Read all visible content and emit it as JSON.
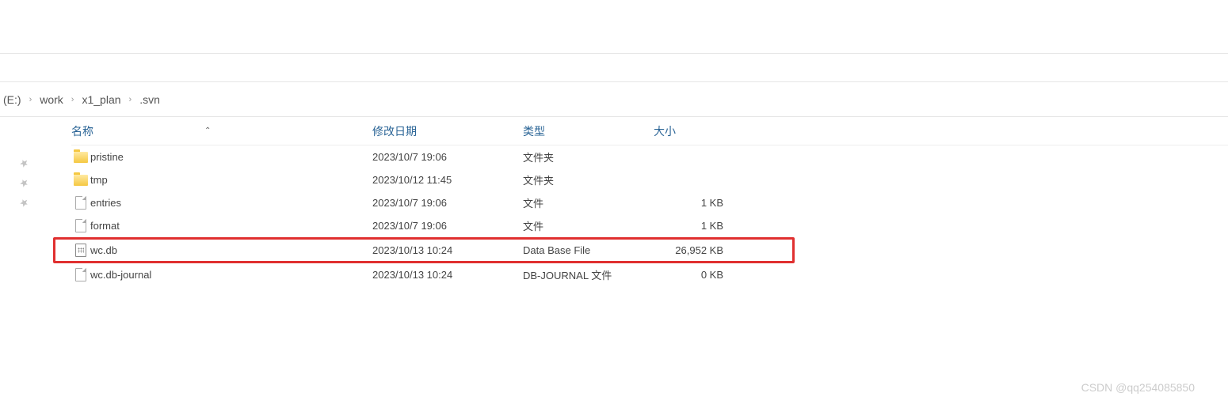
{
  "breadcrumb": {
    "drive_label": "(E:)",
    "items": [
      "work",
      "x1_plan",
      ".svn"
    ]
  },
  "headers": {
    "name": "名称",
    "date": "修改日期",
    "type": "类型",
    "size": "大小"
  },
  "files": [
    {
      "icon": "folder",
      "name": "pristine",
      "date": "2023/10/7 19:06",
      "type": "文件夹",
      "size": "",
      "highlight": false
    },
    {
      "icon": "folder",
      "name": "tmp",
      "date": "2023/10/12 11:45",
      "type": "文件夹",
      "size": "",
      "highlight": false
    },
    {
      "icon": "file",
      "name": "entries",
      "date": "2023/10/7 19:06",
      "type": "文件",
      "size": "1 KB",
      "highlight": false
    },
    {
      "icon": "file",
      "name": "format",
      "date": "2023/10/7 19:06",
      "type": "文件",
      "size": "1 KB",
      "highlight": false
    },
    {
      "icon": "db",
      "name": "wc.db",
      "date": "2023/10/13 10:24",
      "type": "Data Base File",
      "size": "26,952 KB",
      "highlight": true
    },
    {
      "icon": "file",
      "name": "wc.db-journal",
      "date": "2023/10/13 10:24",
      "type": "DB-JOURNAL 文件",
      "size": "0 KB",
      "highlight": false
    }
  ],
  "watermark": "CSDN @qq254085850"
}
